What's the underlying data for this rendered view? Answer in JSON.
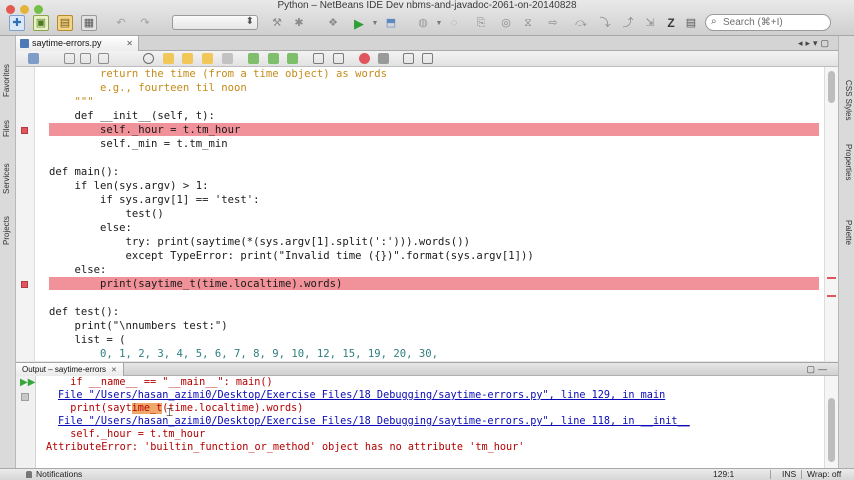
{
  "window": {
    "title": "Python – NetBeans IDE Dev nbms-and-javadoc-2061-on-20140828"
  },
  "toolbar": {
    "config_select": "",
    "search_placeholder": "Search (⌘+I)"
  },
  "left_tabs": [
    "Favorites",
    "Files",
    "Services",
    "Projects"
  ],
  "right_tabs": [
    "CSS Styles",
    "Properties",
    "Palette"
  ],
  "editor": {
    "tab_label": "saytime-errors.py",
    "lines": [
      "        return the time (from a time object) as words",
      "        e.g., fourteen til noon",
      "    \"\"\"",
      "    def __init__(self, t):",
      "        self._hour = t.tm_hour",
      "        self._min = t.tm_min",
      "",
      "def main():",
      "    if len(sys.argv) > 1:",
      "        if sys.argv[1] == 'test':",
      "            test()",
      "        else:",
      "            try: print(saytime(*(sys.argv[1].split(':'))).words())",
      "            except TypeError: print(\"Invalid time ({})\".format(sys.argv[1]))",
      "    else:",
      "        print(saytime_t(time.localtime).words)",
      "",
      "def test():",
      "    print(\"\\nnumbers test:\")",
      "    list = (",
      "        0, 1, 2, 3, 4, 5, 6, 7, 8, 9, 10, 12, 15, 19, 20, 30,"
    ]
  },
  "output": {
    "tab_label": "Output – saytime-errors",
    "lines": [
      "  if __name__ == \"__main__\": main()",
      "File \"/Users/hasan_azimi0/Desktop/Exercise Files/18 Debugging/saytime-errors.py\", line 129, in main",
      "  print(saytime_t(time.localtime).words)",
      "File \"/Users/hasan_azimi0/Desktop/Exercise Files/18 Debugging/saytime-errors.py\", line 118, in __init__",
      "  self._hour = t.tm_hour",
      "AttributeError: 'builtin_function_or_method' object has no attribute 'tm_hour'"
    ],
    "selected_text": "ime_t",
    "selected_line_prefix": "  print(sayt",
    "selected_line_suffix": "(time.localtime).words)"
  },
  "status": {
    "notifications": "Notifications",
    "position": "129:1",
    "insert_mode": "INS",
    "wrap": "Wrap: off"
  },
  "colors": {
    "breakpoint_line": "#f19199",
    "breakpoint_marker": "#e0565c",
    "error_text": "#b40000",
    "link_text": "#0b0bb5",
    "keyword": "#0000cc"
  }
}
